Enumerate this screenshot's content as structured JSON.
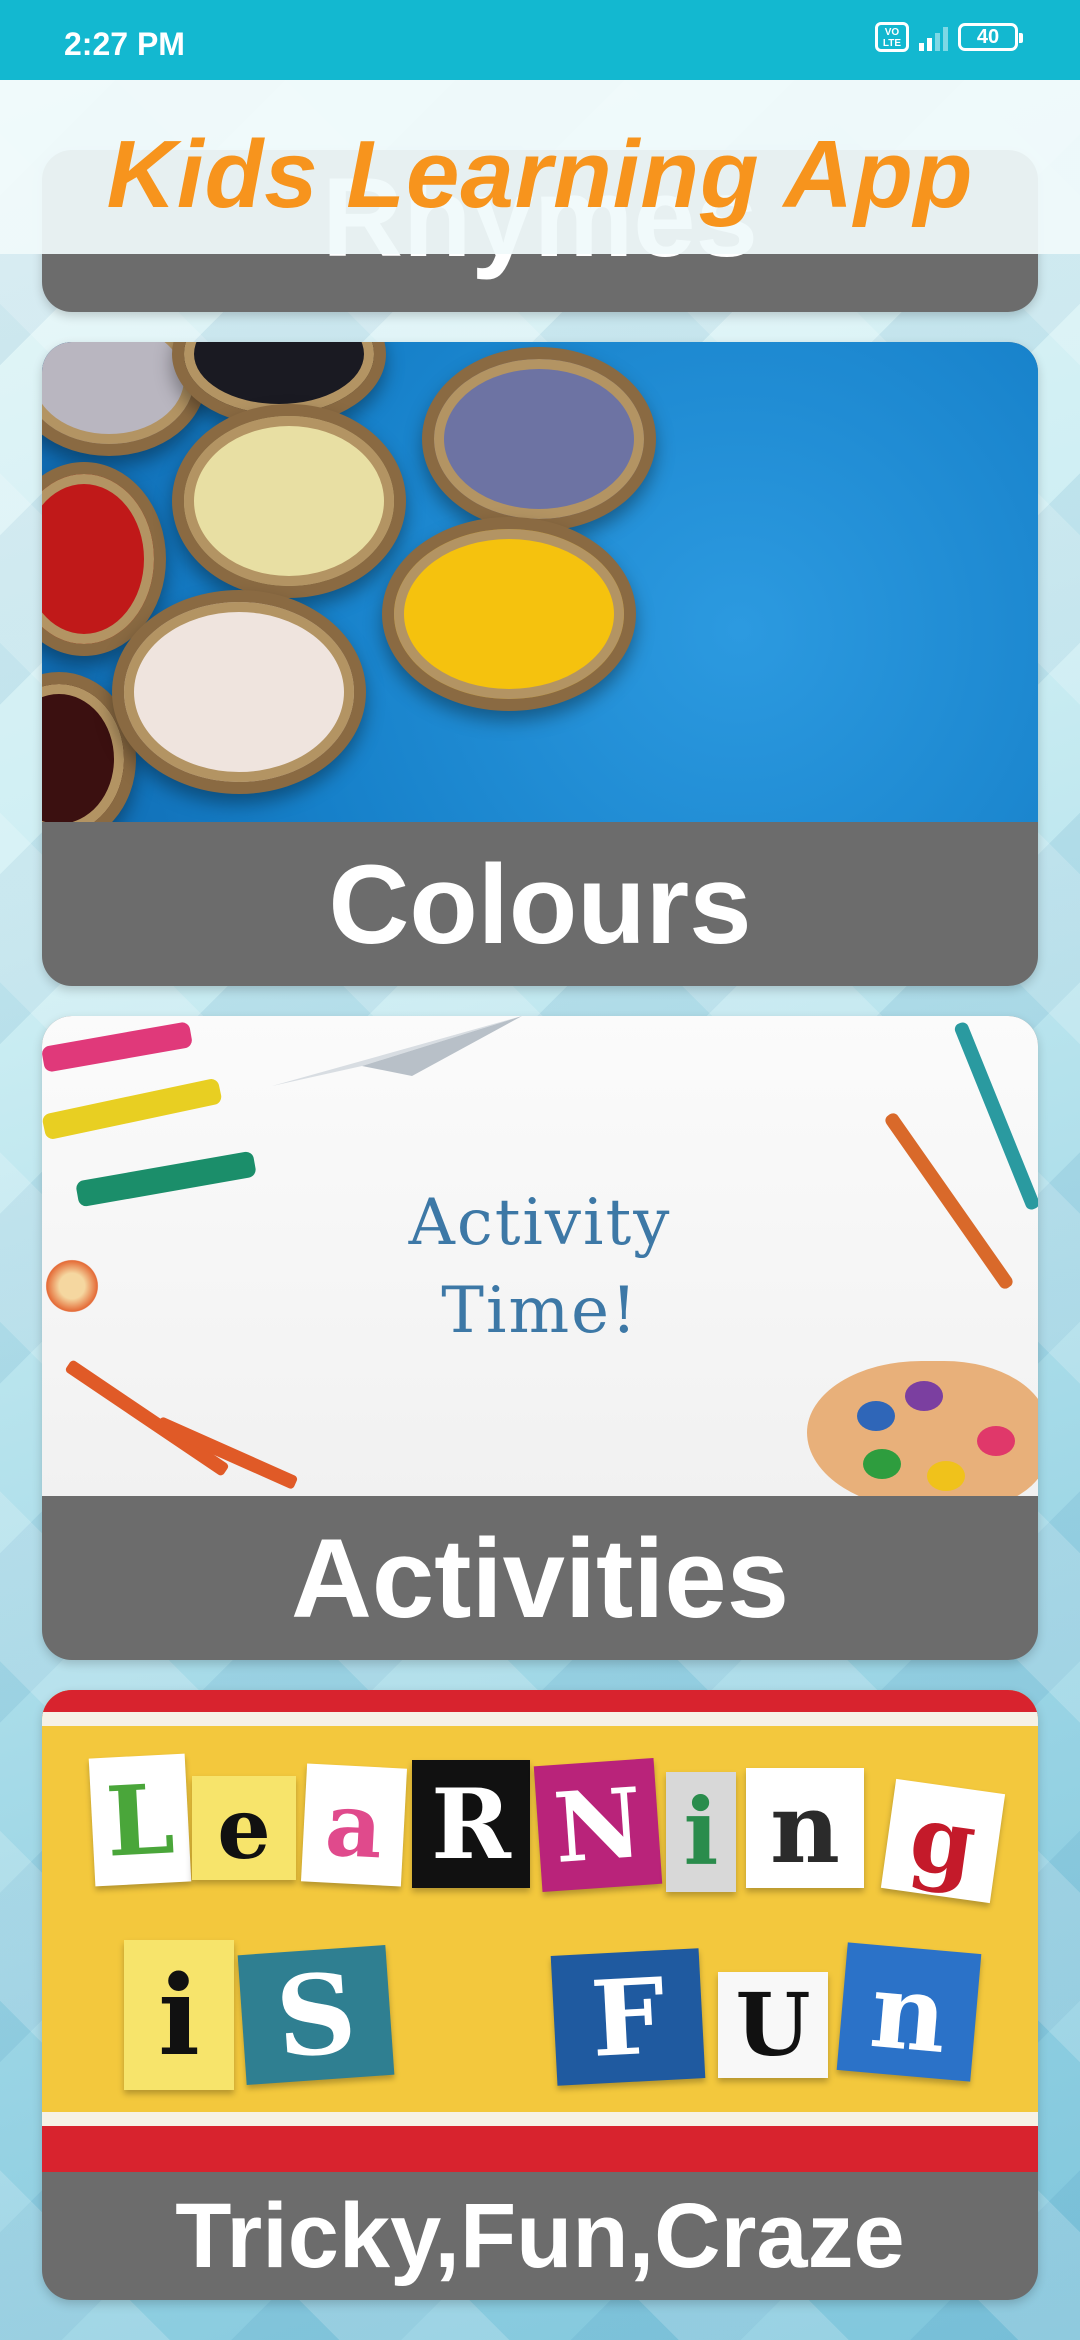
{
  "status_bar": {
    "time": "2:27 PM",
    "network_badge": "Vo\nLTE",
    "battery_level": "40"
  },
  "header": {
    "title": "Kids Learning App",
    "title_color": "#f7941d"
  },
  "cards": [
    {
      "label": "Rhymes"
    },
    {
      "label": "Colours"
    },
    {
      "label": "Activities",
      "image_text_line1": "Activity",
      "image_text_line2": "Time!"
    },
    {
      "label": "Tricky,Fun,Craze",
      "image_word1": [
        "L",
        "e",
        "a",
        "R",
        "N",
        "i",
        "n",
        "g"
      ],
      "image_word2": [
        "i",
        "S"
      ],
      "image_word3": [
        "F",
        "U",
        "n"
      ]
    }
  ],
  "colors": {
    "status_bar": "#13b8d0",
    "card_label_bg": "#6c6c6c"
  }
}
